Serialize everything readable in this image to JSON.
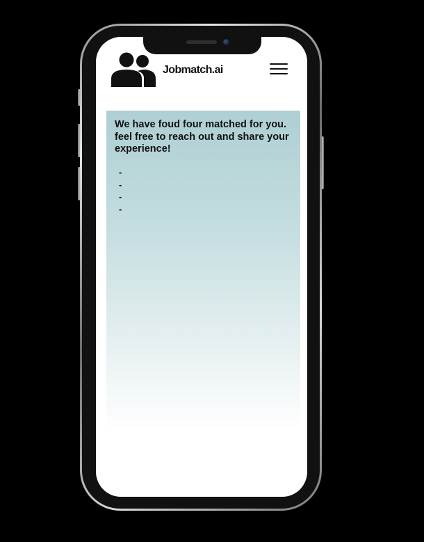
{
  "app": {
    "title": "Jobmatch.ai",
    "logo_icon": "users-icon",
    "menu_icon": "hamburger-menu-icon"
  },
  "match_card": {
    "message": "We have foud four matched for you. feel free to reach out and share your experience!",
    "matches": [
      {
        "marker": "-",
        "text": ""
      },
      {
        "marker": "-",
        "text": ""
      },
      {
        "marker": "-",
        "text": ""
      },
      {
        "marker": "-",
        "text": ""
      }
    ]
  },
  "colors": {
    "background": "#000000",
    "screen": "#ffffff",
    "card_gradient_top": "#aecfd3",
    "card_gradient_bottom": "#ffffff",
    "text": "#111111"
  }
}
